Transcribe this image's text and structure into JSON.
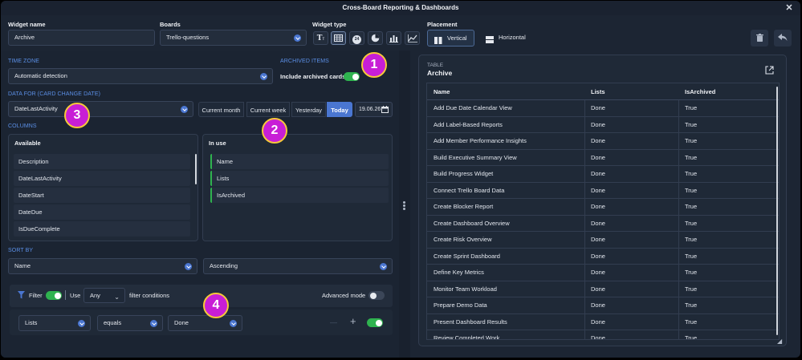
{
  "window": {
    "title": "Cross-Board Reporting & Dashboards"
  },
  "widget_name": {
    "label": "Widget name",
    "value": "Archive"
  },
  "boards": {
    "label": "Boards",
    "value": "Trello-questions"
  },
  "widget_type": {
    "label": "Widget type",
    "icons": [
      "text-icon",
      "table-icon",
      "counter-icon",
      "pie-chart-icon",
      "bar-chart-icon",
      "line-chart-icon"
    ],
    "counter_glyph": "24",
    "text_glyph": "Tт"
  },
  "placement": {
    "label": "Placement",
    "vertical": "Vertical",
    "horizontal": "Horizontal"
  },
  "time_zone": {
    "label": "TIME ZONE",
    "value": "Automatic detection"
  },
  "archived": {
    "label": "ARCHIVED ITEMS",
    "toggle_label": "Include archived cards"
  },
  "data_for": {
    "label": "DATA FOR (CARD CHANGE DATE)",
    "value": "DateLastActivity",
    "options": [
      "Current month",
      "Current week",
      "Yesterday",
      "Today"
    ],
    "selected": "Today",
    "date": "19.06.26"
  },
  "columns": {
    "label": "COLUMNS",
    "available_header": "Available",
    "available": [
      "Description",
      "DateLastActivity",
      "DateStart",
      "DateDue",
      "IsDueComplete"
    ],
    "in_use_header": "In use",
    "in_use": [
      "Name",
      "Lists",
      "IsArchived"
    ]
  },
  "sort_by": {
    "label": "SORT BY",
    "field": "Name",
    "order": "Ascending"
  },
  "filter": {
    "label": "Filter",
    "use": "Use",
    "any": "Any",
    "conditions": "filter conditions",
    "advanced": "Advanced mode",
    "row": {
      "field": "Lists",
      "operator": "equals",
      "value": "Done"
    },
    "minus": "—",
    "plus": "+"
  },
  "preview": {
    "kind": "TABLE",
    "title": "Archive",
    "headers": [
      "Name",
      "Lists",
      "IsArchived"
    ],
    "rows": [
      [
        "Add Due Date Calendar View",
        "Done",
        "True"
      ],
      [
        "Add Label-Based Reports",
        "Done",
        "True"
      ],
      [
        "Add Member Performance Insights",
        "Done",
        "True"
      ],
      [
        "Build Executive Summary View",
        "Done",
        "True"
      ],
      [
        "Build Progress Widget",
        "Done",
        "True"
      ],
      [
        "Connect Trello Board Data",
        "Done",
        "True"
      ],
      [
        "Create Blocker Report",
        "Done",
        "True"
      ],
      [
        "Create Dashboard Overview",
        "Done",
        "True"
      ],
      [
        "Create Risk Overview",
        "Done",
        "True"
      ],
      [
        "Create Sprint Dashboard",
        "Done",
        "True"
      ],
      [
        "Define Key Metrics",
        "Done",
        "True"
      ],
      [
        "Monitor Team Workload",
        "Done",
        "True"
      ],
      [
        "Prepare Demo Data",
        "Done",
        "True"
      ],
      [
        "Present Dashboard Results",
        "Done",
        "True"
      ],
      [
        "Review Completed Work",
        "Done",
        "True"
      ]
    ]
  },
  "badges": [
    "1",
    "2",
    "3",
    "4"
  ],
  "colors": {
    "accent": "#4a76d1",
    "toggle_on": "#2fb34f",
    "badge": "#c81ed6",
    "badge_ring": "#f6c83a",
    "section": "#5b8fe6"
  }
}
